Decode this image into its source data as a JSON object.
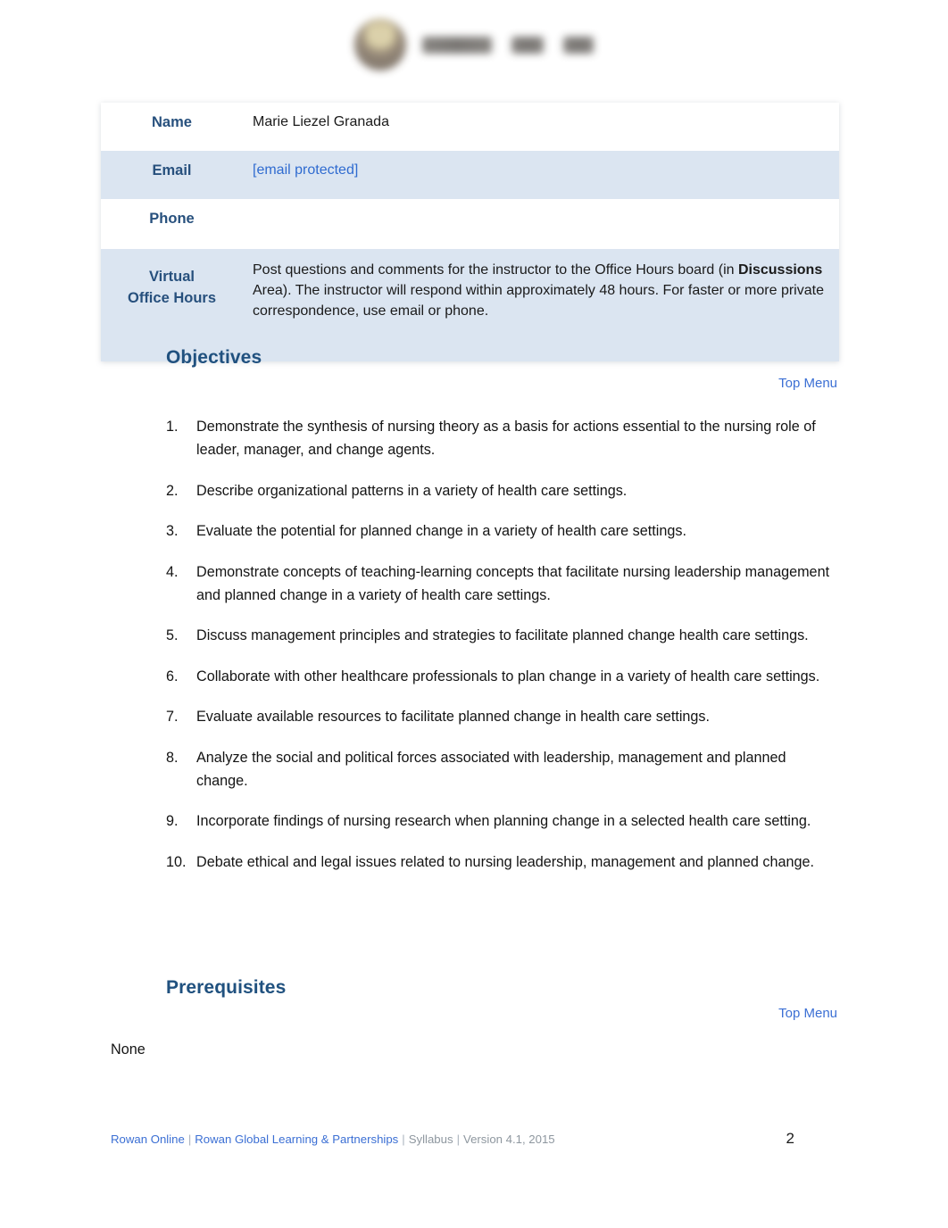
{
  "header": {
    "logo_alt": "Rowan Online seal logo"
  },
  "info_table": {
    "rows": [
      {
        "label": "Name",
        "value": "Marie Liezel Granada",
        "shaded": false
      },
      {
        "label": "Email",
        "value": "[email protected]",
        "shaded": true
      },
      {
        "label": "Phone",
        "value": "",
        "shaded": false
      }
    ],
    "office_hours": {
      "label_line1": "Virtual",
      "label_line2": "Office Hours",
      "text_part1": "Post questions and comments for the instructor to the Office Hours board (in ",
      "text_bold": "Discussions",
      "text_part2": " Area).  The instructor will respond within approximately 48 hours.  For faster or more private correspondence, use email or phone."
    }
  },
  "objectives": {
    "heading": "Objectives",
    "top_menu_label": "Top Menu",
    "items": [
      {
        "number": "1.",
        "text": "Demonstrate the synthesis of nursing theory as a basis for actions essential to the nursing role of leader, manager, and change agents."
      },
      {
        "number": "2.",
        "text": "Describe organizational patterns in a variety of health care settings."
      },
      {
        "number": "3.",
        "text": "Evaluate the potential for planned change in a variety of health care settings."
      },
      {
        "number": "4.",
        "text": "Demonstrate concepts of teaching-learning concepts that facilitate nursing leadership management and planned change in a variety of health care settings."
      },
      {
        "number": "5.",
        "text": "Discuss management principles and strategies to facilitate planned change health care settings."
      },
      {
        "number": "6.",
        "text": "Collaborate with other healthcare professionals to plan change in a variety of health care settings."
      },
      {
        "number": "7.",
        "text": "Evaluate available resources to facilitate planned change in health care settings."
      },
      {
        "number": "8.",
        "text": "Analyze the social and political forces associated with leadership, management and planned change."
      },
      {
        "number": "9.",
        "text": "Incorporate findings of nursing research when planning change in a selected health care setting."
      },
      {
        "number": "10.",
        "text": "Debate ethical and legal issues related to nursing leadership, management and planned change."
      }
    ]
  },
  "prerequisites": {
    "heading": "Prerequisites",
    "top_menu_label": "Top Menu",
    "body": "None"
  },
  "footer": {
    "link1": "Rowan Online",
    "link2": "Rowan Global Learning & Partnerships",
    "item3": "Syllabus",
    "item4": "Version 4.1, 2015",
    "separator": "|",
    "page_number": "2"
  },
  "colors": {
    "heading_blue": "#20517f",
    "label_blue": "#27507d",
    "link_blue": "#3b6fd4",
    "row_shade": "#dbe5f1"
  }
}
